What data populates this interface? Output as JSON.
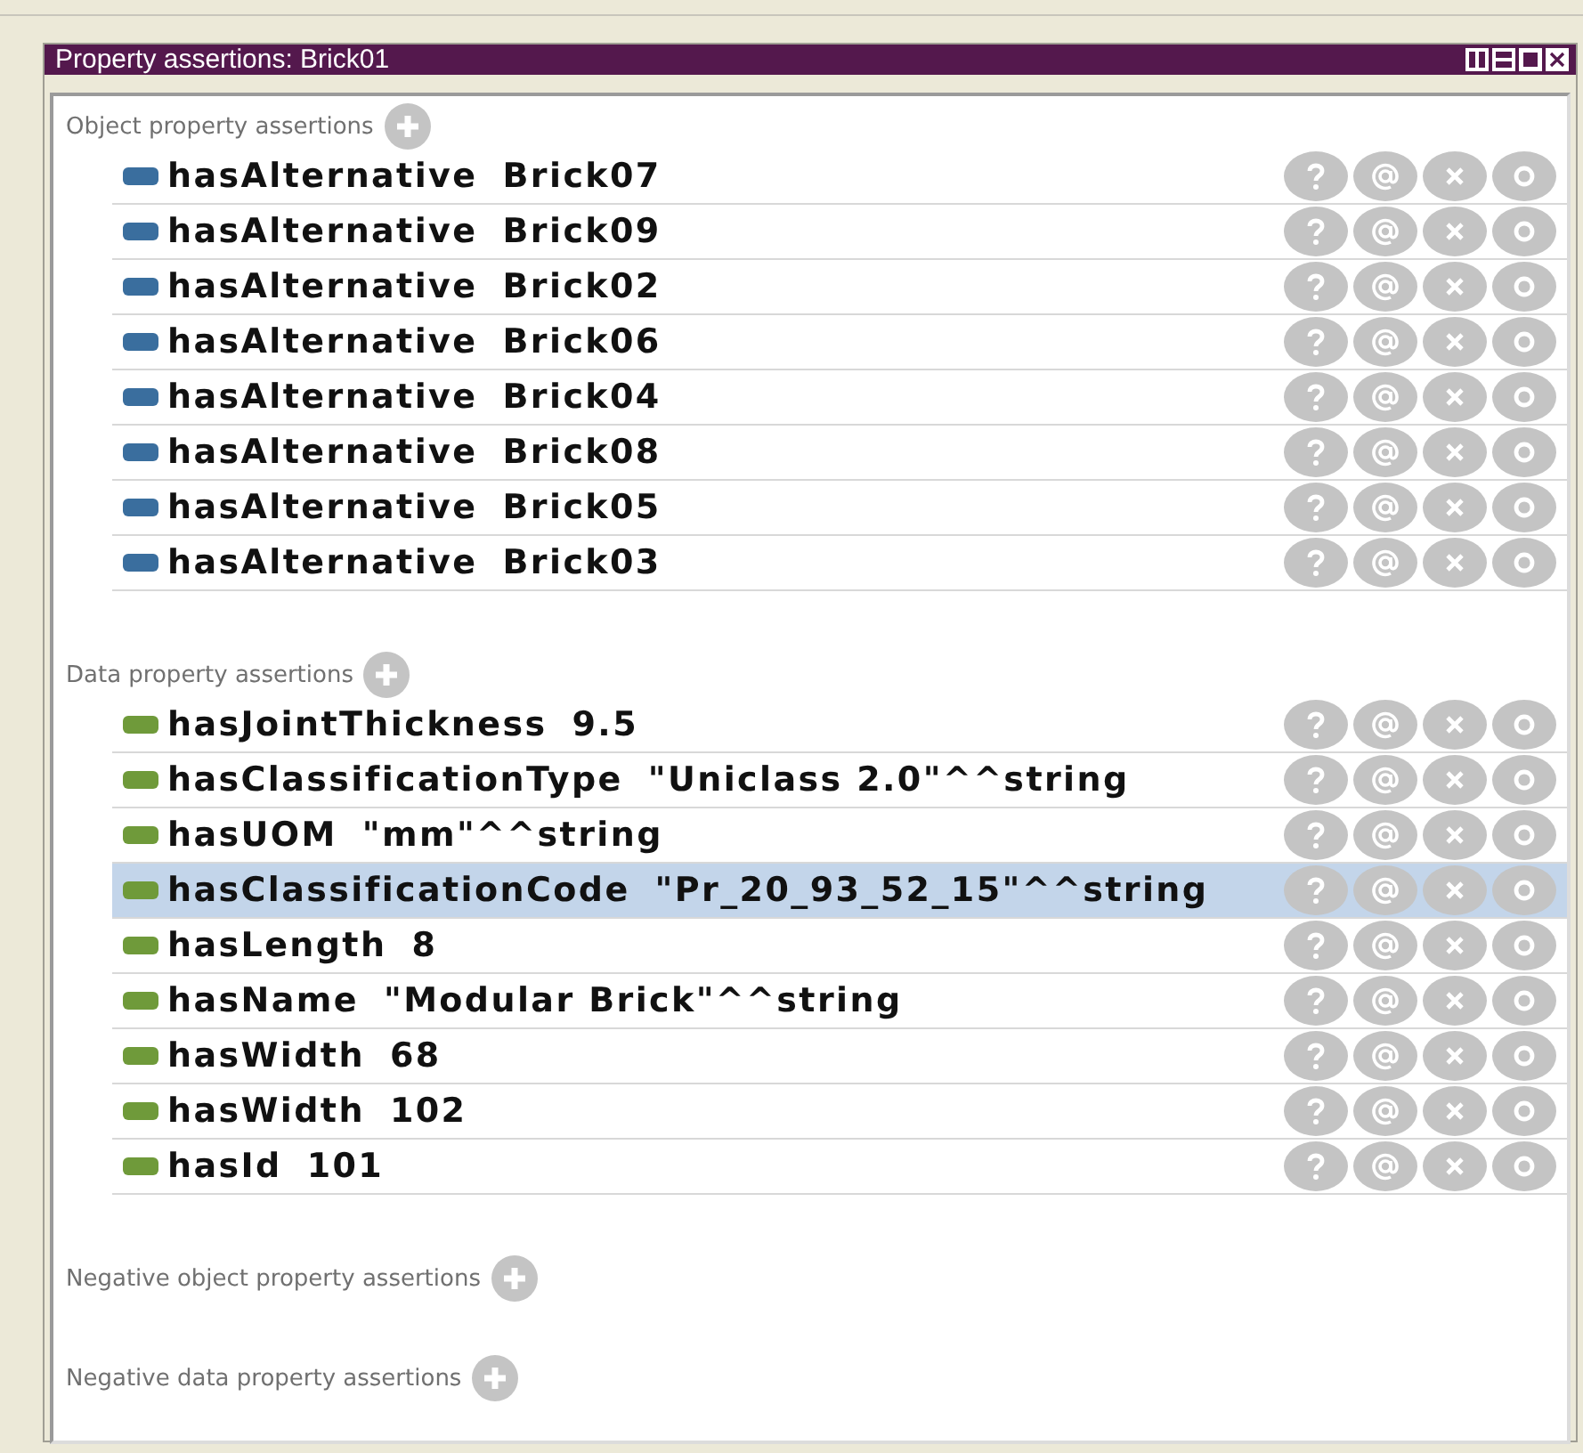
{
  "panel": {
    "title": "Property assertions: Brick01"
  },
  "sections": [
    {
      "title": "Object property assertions",
      "kind": "object",
      "rows": [
        {
          "property": "hasAlternative",
          "value": "Brick07",
          "selected": false
        },
        {
          "property": "hasAlternative",
          "value": "Brick09",
          "selected": false
        },
        {
          "property": "hasAlternative",
          "value": "Brick02",
          "selected": false
        },
        {
          "property": "hasAlternative",
          "value": "Brick06",
          "selected": false
        },
        {
          "property": "hasAlternative",
          "value": "Brick04",
          "selected": false
        },
        {
          "property": "hasAlternative",
          "value": "Brick08",
          "selected": false
        },
        {
          "property": "hasAlternative",
          "value": "Brick05",
          "selected": false
        },
        {
          "property": "hasAlternative",
          "value": "Brick03",
          "selected": false
        }
      ]
    },
    {
      "title": "Data property assertions",
      "kind": "data",
      "rows": [
        {
          "property": "hasJointThickness",
          "value": "9.5",
          "selected": false
        },
        {
          "property": "hasClassificationType",
          "value": "\"Uniclass 2.0\"^^string",
          "selected": false
        },
        {
          "property": "hasUOM",
          "value": "\"mm\"^^string",
          "selected": false
        },
        {
          "property": "hasClassificationCode",
          "value": "\"Pr_20_93_52_15\"^^string",
          "selected": true
        },
        {
          "property": "hasLength",
          "value": "8",
          "selected": false
        },
        {
          "property": "hasName",
          "value": "\"Modular Brick\"^^string",
          "selected": false
        },
        {
          "property": "hasWidth",
          "value": "68",
          "selected": false
        },
        {
          "property": "hasWidth",
          "value": "102",
          "selected": false
        },
        {
          "property": "hasId",
          "value": "101",
          "selected": false
        }
      ]
    },
    {
      "title": "Negative object property assertions"
    },
    {
      "title": "Negative data property assertions"
    }
  ]
}
